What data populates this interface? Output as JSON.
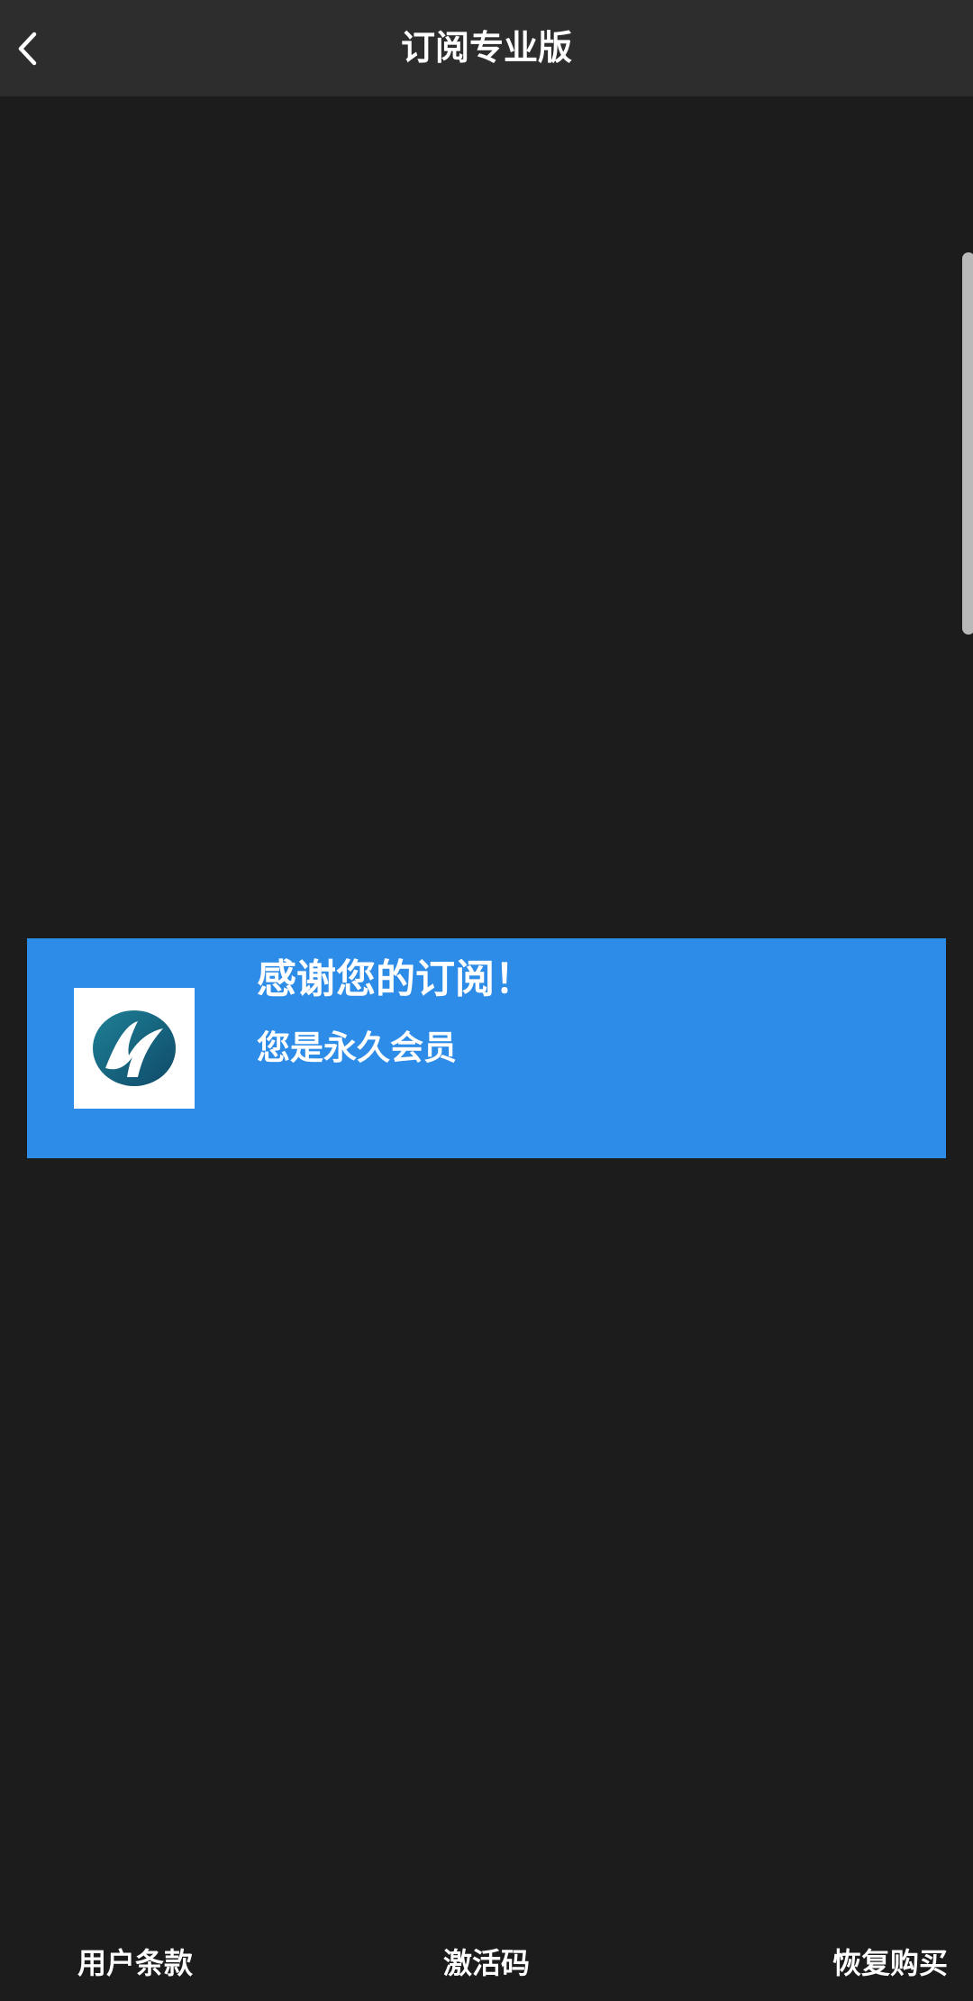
{
  "header": {
    "title": "订阅专业版",
    "back_icon": "chevron-left-icon"
  },
  "banner": {
    "title": "感谢您的订阅！",
    "subtitle": "您是永久会员",
    "logo_icon": "app-logo-icon",
    "background_color": "#2e8ce9"
  },
  "footer": {
    "terms_label": "用户条款",
    "activation_label": "激活码",
    "restore_label": "恢复购买"
  },
  "colors": {
    "background": "#1c1c1c",
    "header_background": "#2d2d2d",
    "text": "#ffffff"
  }
}
